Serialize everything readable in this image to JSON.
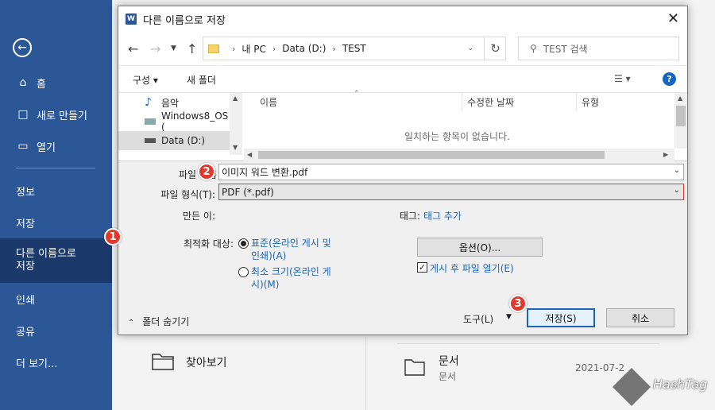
{
  "sidebar": {
    "items": [
      {
        "label": "홈",
        "icon": "home-icon"
      },
      {
        "label": "새로 만들기",
        "icon": "new-document-icon"
      },
      {
        "label": "열기",
        "icon": "open-folder-icon"
      },
      {
        "label": "정보"
      },
      {
        "label": "저장"
      },
      {
        "label": "다른 이름으로 저장"
      },
      {
        "label": "인쇄"
      },
      {
        "label": "공유"
      },
      {
        "label": "더 보기..."
      }
    ]
  },
  "background": {
    "browse_label": "찾아보기",
    "folder_name": "문서",
    "folder_sub": "문서",
    "folder_date": "2021-07-2",
    "watermark": "HashTag"
  },
  "dialog": {
    "title": "다른 이름으로 저장",
    "address": {
      "segments": [
        "내 PC",
        "Data (D:)",
        "TEST"
      ]
    },
    "search_placeholder": "TEST 검색",
    "toolbar": {
      "organize": "구성",
      "new_folder": "새 폴더"
    },
    "navpane": [
      {
        "label": "음악",
        "icon": "music-icon"
      },
      {
        "label": "Windows8_OS (",
        "icon": "drive-icon"
      },
      {
        "label": "Data (D:)",
        "icon": "drive-icon"
      }
    ],
    "columns": [
      "이름",
      "수정한 날짜",
      "유형"
    ],
    "empty_message": "일치하는 항목이 없습니다.",
    "filename_label": "파일 이름",
    "filename_value": "이미지 워드 변환.pdf",
    "filetype_label": "파일 형식(T):",
    "filetype_value": "PDF (*.pdf)",
    "author_label": "만든 이:",
    "tags_label": "태그:",
    "tags_value": "태그 추가",
    "optimize_label": "최적화 대상:",
    "optimize_standard": "표준(온라인 게시 및 인쇄)(A)",
    "optimize_minimum": "최소 크기(온라인 게시)(M)",
    "options_button": "옵션(O)...",
    "open_after_label": "게시 후 파일 열기(E)",
    "hide_folders": "폴더 숨기기",
    "tools_label": "도구(L)",
    "save_button": "저장(S)",
    "cancel_button": "취소"
  },
  "annotations": [
    "1",
    "2",
    "3"
  ]
}
